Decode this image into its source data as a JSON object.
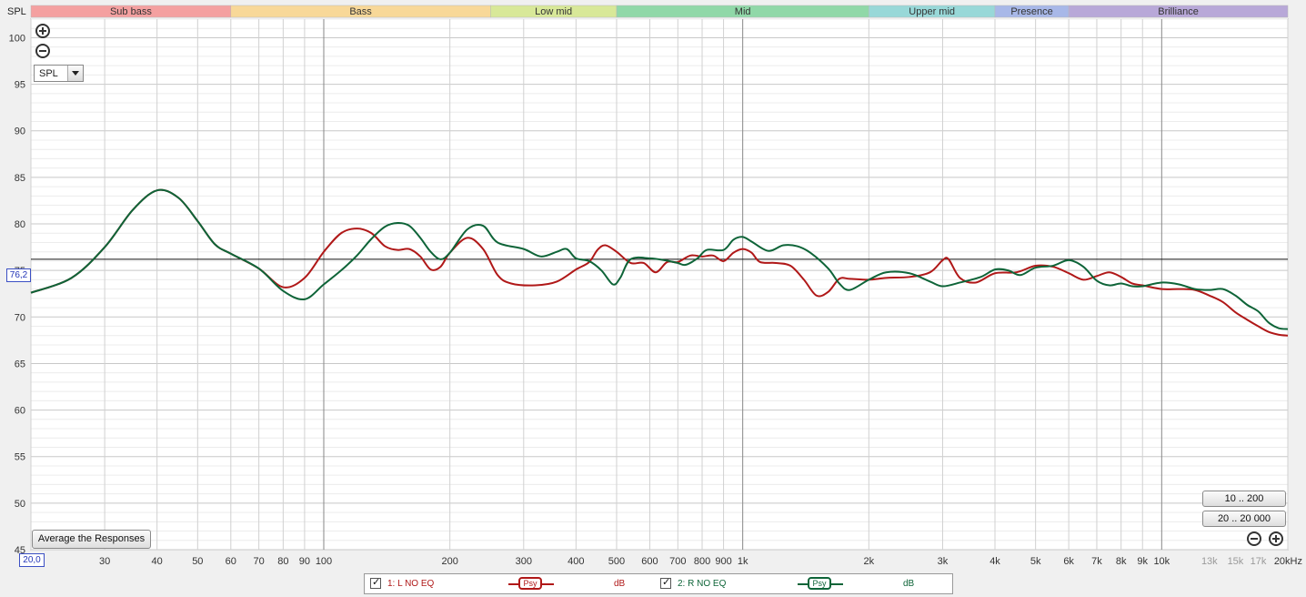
{
  "axis": {
    "y_title": "SPL",
    "y_ticks": [
      "100",
      "95",
      "90",
      "85",
      "80",
      "75",
      "70",
      "65",
      "60",
      "55",
      "50",
      "45"
    ],
    "x_tick_labels": [
      "30",
      "40",
      "50",
      "60",
      "70",
      "80",
      "90",
      "100",
      "200",
      "300",
      "400",
      "500",
      "600",
      "700",
      "800",
      "900",
      "1k",
      "2k",
      "3k",
      "4k",
      "5k",
      "6k",
      "7k",
      "8k",
      "9k",
      "10k",
      "13k",
      "15k",
      "17k",
      "20kHz"
    ]
  },
  "cursor": {
    "value_label": "76,2",
    "x_min_label": "20,0"
  },
  "bands": [
    {
      "name": "Sub bass",
      "color": "#f4a0a0"
    },
    {
      "name": "Bass",
      "color": "#f8d898"
    },
    {
      "name": "Low mid",
      "color": "#d8e898"
    },
    {
      "name": "Mid",
      "color": "#90d8a8"
    },
    {
      "name": "Upper mid",
      "color": "#98d8d8"
    },
    {
      "name": "Presence",
      "color": "#a8b8e8"
    },
    {
      "name": "Brilliance",
      "color": "#b8a8d8"
    }
  ],
  "controls": {
    "select_value": "SPL",
    "average_label": "Average the Responses",
    "range1_label": "10 .. 200",
    "range2_label": "20 .. 20 000"
  },
  "legend": {
    "m1_label": "1: L NO EQ",
    "m1_psy": "Psy",
    "m1_unit": "dB",
    "m2_label": "2: R NO EQ",
    "m2_psy": "Psy",
    "m2_unit": "dB"
  },
  "chart_data": {
    "type": "line",
    "x_scale": "log",
    "xlim": [
      20,
      20000
    ],
    "ylim": [
      45,
      102
    ],
    "ylabel": "SPL",
    "xlabel": "",
    "grid": true,
    "cursor_level": 76.2,
    "bands": [
      {
        "name": "Sub bass",
        "from": 10,
        "to": 60
      },
      {
        "name": "Bass",
        "from": 60,
        "to": 250
      },
      {
        "name": "Low mid",
        "from": 250,
        "to": 500
      },
      {
        "name": "Mid",
        "from": 500,
        "to": 2000
      },
      {
        "name": "Upper mid",
        "from": 2000,
        "to": 4000
      },
      {
        "name": "Presence",
        "from": 4000,
        "to": 6000
      },
      {
        "name": "Brilliance",
        "from": 6000,
        "to": 20000
      }
    ],
    "series": [
      {
        "name": "1: L NO EQ",
        "color": "#b01818",
        "points": [
          [
            20,
            72.6
          ],
          [
            25,
            74.2
          ],
          [
            30,
            77.5
          ],
          [
            35,
            81.5
          ],
          [
            40,
            83.6
          ],
          [
            45,
            82.8
          ],
          [
            50,
            80.3
          ],
          [
            55,
            77.8
          ],
          [
            60,
            76.8
          ],
          [
            70,
            75.2
          ],
          [
            80,
            73.2
          ],
          [
            90,
            74.2
          ],
          [
            100,
            77.0
          ],
          [
            110,
            79.0
          ],
          [
            120,
            79.5
          ],
          [
            130,
            79.0
          ],
          [
            140,
            77.6
          ],
          [
            150,
            77.2
          ],
          [
            160,
            77.3
          ],
          [
            170,
            76.5
          ],
          [
            180,
            75.1
          ],
          [
            190,
            75.4
          ],
          [
            200,
            76.9
          ],
          [
            220,
            78.5
          ],
          [
            240,
            77.3
          ],
          [
            260,
            74.5
          ],
          [
            280,
            73.6
          ],
          [
            320,
            73.4
          ],
          [
            360,
            73.8
          ],
          [
            400,
            75.1
          ],
          [
            430,
            75.9
          ],
          [
            450,
            77.2
          ],
          [
            470,
            77.7
          ],
          [
            500,
            77.0
          ],
          [
            540,
            75.8
          ],
          [
            580,
            75.8
          ],
          [
            620,
            74.8
          ],
          [
            660,
            75.9
          ],
          [
            700,
            75.9
          ],
          [
            750,
            76.6
          ],
          [
            800,
            76.5
          ],
          [
            850,
            76.6
          ],
          [
            900,
            76.0
          ],
          [
            950,
            76.9
          ],
          [
            1000,
            77.3
          ],
          [
            1050,
            76.9
          ],
          [
            1100,
            75.9
          ],
          [
            1200,
            75.8
          ],
          [
            1300,
            75.5
          ],
          [
            1400,
            74.0
          ],
          [
            1500,
            72.3
          ],
          [
            1600,
            72.7
          ],
          [
            1700,
            74.1
          ],
          [
            1800,
            74.1
          ],
          [
            2000,
            74.0
          ],
          [
            2200,
            74.2
          ],
          [
            2500,
            74.3
          ],
          [
            2800,
            74.8
          ],
          [
            3000,
            76.1
          ],
          [
            3100,
            76.2
          ],
          [
            3300,
            74.2
          ],
          [
            3600,
            73.7
          ],
          [
            4000,
            74.7
          ],
          [
            4500,
            74.8
          ],
          [
            5000,
            75.5
          ],
          [
            5500,
            75.4
          ],
          [
            6000,
            74.7
          ],
          [
            6500,
            74.0
          ],
          [
            7000,
            74.4
          ],
          [
            7500,
            74.8
          ],
          [
            8000,
            74.3
          ],
          [
            8500,
            73.6
          ],
          [
            9000,
            73.4
          ],
          [
            10000,
            73.0
          ],
          [
            11000,
            73.0
          ],
          [
            12000,
            72.9
          ],
          [
            13000,
            72.3
          ],
          [
            14000,
            71.6
          ],
          [
            15000,
            70.5
          ],
          [
            16000,
            69.7
          ],
          [
            17000,
            69.0
          ],
          [
            18000,
            68.4
          ],
          [
            19000,
            68.1
          ],
          [
            20000,
            68.0
          ]
        ]
      },
      {
        "name": "2: R NO EQ",
        "color": "#0e6438",
        "points": [
          [
            20,
            72.6
          ],
          [
            25,
            74.2
          ],
          [
            30,
            77.5
          ],
          [
            35,
            81.5
          ],
          [
            40,
            83.6
          ],
          [
            45,
            82.8
          ],
          [
            50,
            80.3
          ],
          [
            55,
            77.8
          ],
          [
            60,
            76.8
          ],
          [
            70,
            75.2
          ],
          [
            80,
            72.8
          ],
          [
            90,
            71.9
          ],
          [
            100,
            73.5
          ],
          [
            110,
            75.0
          ],
          [
            120,
            76.6
          ],
          [
            130,
            78.4
          ],
          [
            140,
            79.7
          ],
          [
            150,
            80.1
          ],
          [
            160,
            79.8
          ],
          [
            170,
            78.5
          ],
          [
            180,
            77.0
          ],
          [
            190,
            76.2
          ],
          [
            200,
            76.9
          ],
          [
            220,
            79.4
          ],
          [
            240,
            79.8
          ],
          [
            260,
            78.0
          ],
          [
            300,
            77.3
          ],
          [
            330,
            76.5
          ],
          [
            360,
            77.0
          ],
          [
            380,
            77.3
          ],
          [
            400,
            76.3
          ],
          [
            430,
            76.0
          ],
          [
            460,
            75.0
          ],
          [
            490,
            73.5
          ],
          [
            510,
            74.2
          ],
          [
            540,
            76.2
          ],
          [
            600,
            76.3
          ],
          [
            650,
            76.1
          ],
          [
            700,
            75.8
          ],
          [
            730,
            75.6
          ],
          [
            780,
            76.3
          ],
          [
            820,
            77.2
          ],
          [
            900,
            77.2
          ],
          [
            950,
            78.3
          ],
          [
            1000,
            78.6
          ],
          [
            1050,
            78.1
          ],
          [
            1150,
            77.1
          ],
          [
            1250,
            77.7
          ],
          [
            1350,
            77.6
          ],
          [
            1450,
            76.9
          ],
          [
            1600,
            75.2
          ],
          [
            1700,
            73.6
          ],
          [
            1800,
            72.9
          ],
          [
            2000,
            74.0
          ],
          [
            2200,
            74.8
          ],
          [
            2500,
            74.7
          ],
          [
            2800,
            73.8
          ],
          [
            3000,
            73.3
          ],
          [
            3300,
            73.7
          ],
          [
            3700,
            74.3
          ],
          [
            4000,
            75.1
          ],
          [
            4300,
            75.0
          ],
          [
            4600,
            74.5
          ],
          [
            5000,
            75.3
          ],
          [
            5500,
            75.5
          ],
          [
            6000,
            76.1
          ],
          [
            6500,
            75.4
          ],
          [
            7000,
            73.9
          ],
          [
            7500,
            73.4
          ],
          [
            8000,
            73.6
          ],
          [
            8500,
            73.3
          ],
          [
            9000,
            73.3
          ],
          [
            10000,
            73.7
          ],
          [
            11000,
            73.5
          ],
          [
            12000,
            73.0
          ],
          [
            13000,
            72.9
          ],
          [
            14000,
            73.0
          ],
          [
            15000,
            72.3
          ],
          [
            16000,
            71.3
          ],
          [
            17000,
            70.6
          ],
          [
            18000,
            69.4
          ],
          [
            19000,
            68.8
          ],
          [
            20000,
            68.7
          ]
        ]
      }
    ]
  }
}
